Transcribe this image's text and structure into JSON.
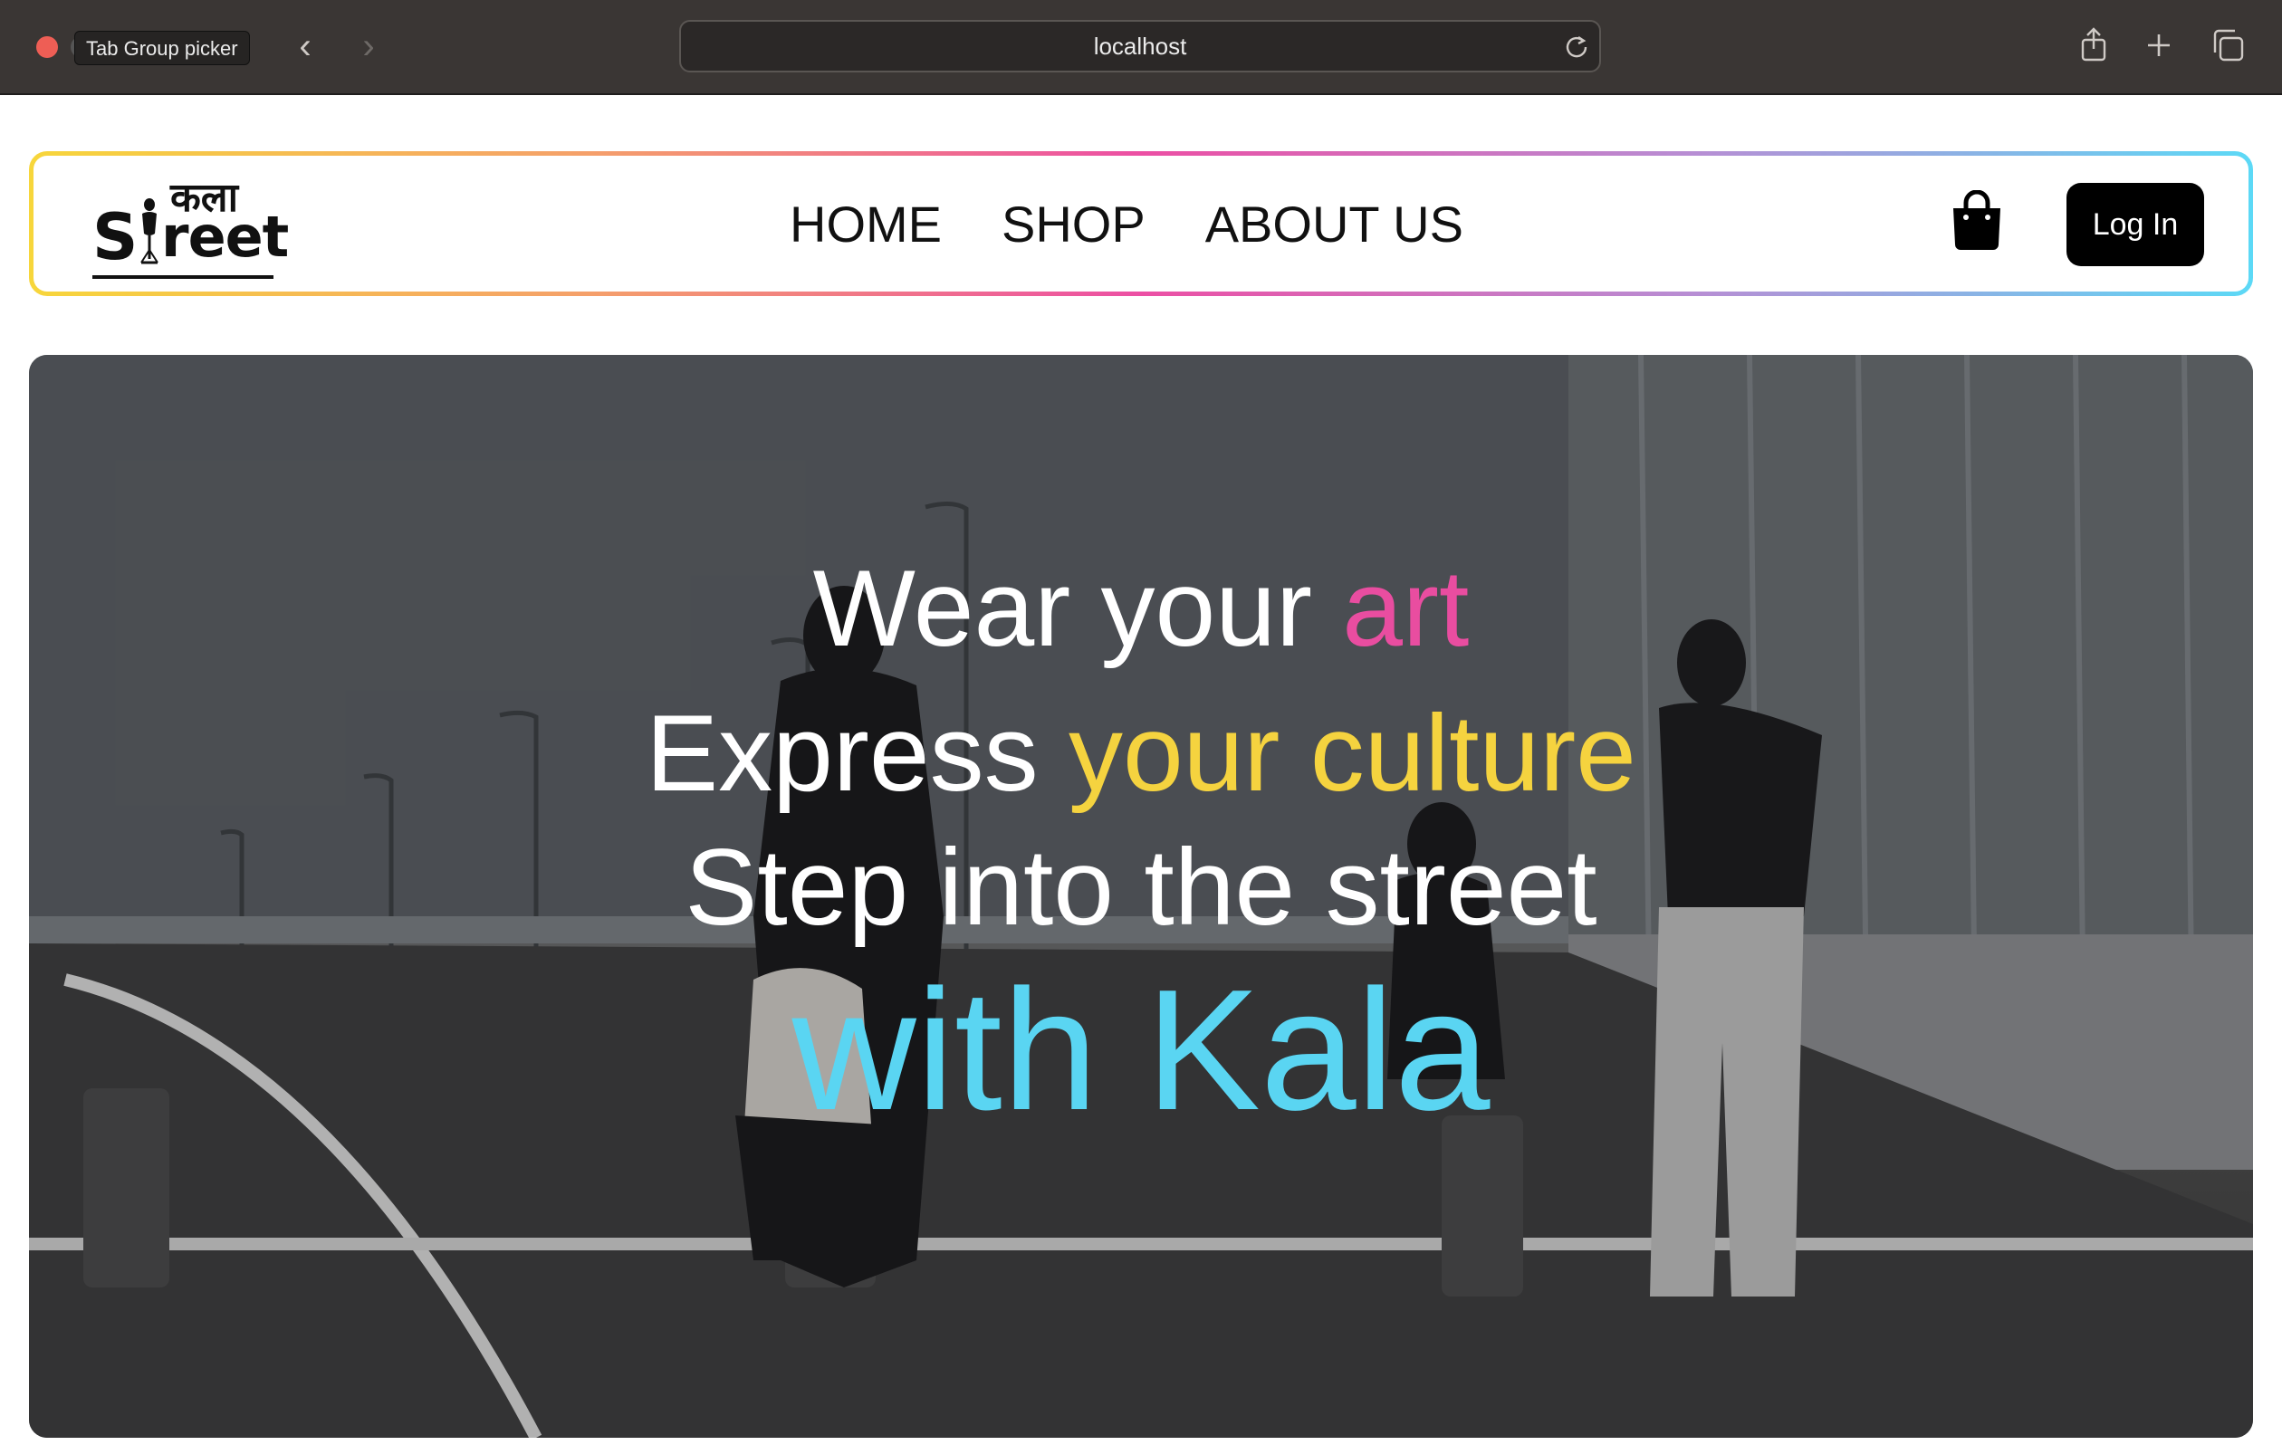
{
  "browser": {
    "tab_tooltip": "Tab Group picker",
    "url": "localhost",
    "back_icon": "chevron-left-icon",
    "forward_icon": "chevron-right-icon"
  },
  "site": {
    "logo": {
      "hindi": "कला",
      "s": "S",
      "rest": "reet",
      "alt": "कला Street"
    },
    "nav": [
      {
        "label": "HOME"
      },
      {
        "label": "SHOP"
      },
      {
        "label": "ABOUT US"
      }
    ],
    "cart_icon": "shopping-bag-icon",
    "login_label": "Log In"
  },
  "hero": {
    "line1": {
      "text": "Wear your ",
      "accent": "art"
    },
    "line2": {
      "text": "Express ",
      "accent": "your culture"
    },
    "line3": {
      "text": "Step into the street"
    },
    "line4": {
      "text": "with Kala"
    }
  },
  "colors": {
    "accent_pink": "#e94da0",
    "accent_yellow": "#f5d33f",
    "accent_cyan": "#5ad5f2",
    "border_gradient": [
      "#f7d63b",
      "#f5a06a",
      "#ec4fa4",
      "#b78ed4",
      "#5cd9f6"
    ],
    "login_bg": "#000000"
  }
}
